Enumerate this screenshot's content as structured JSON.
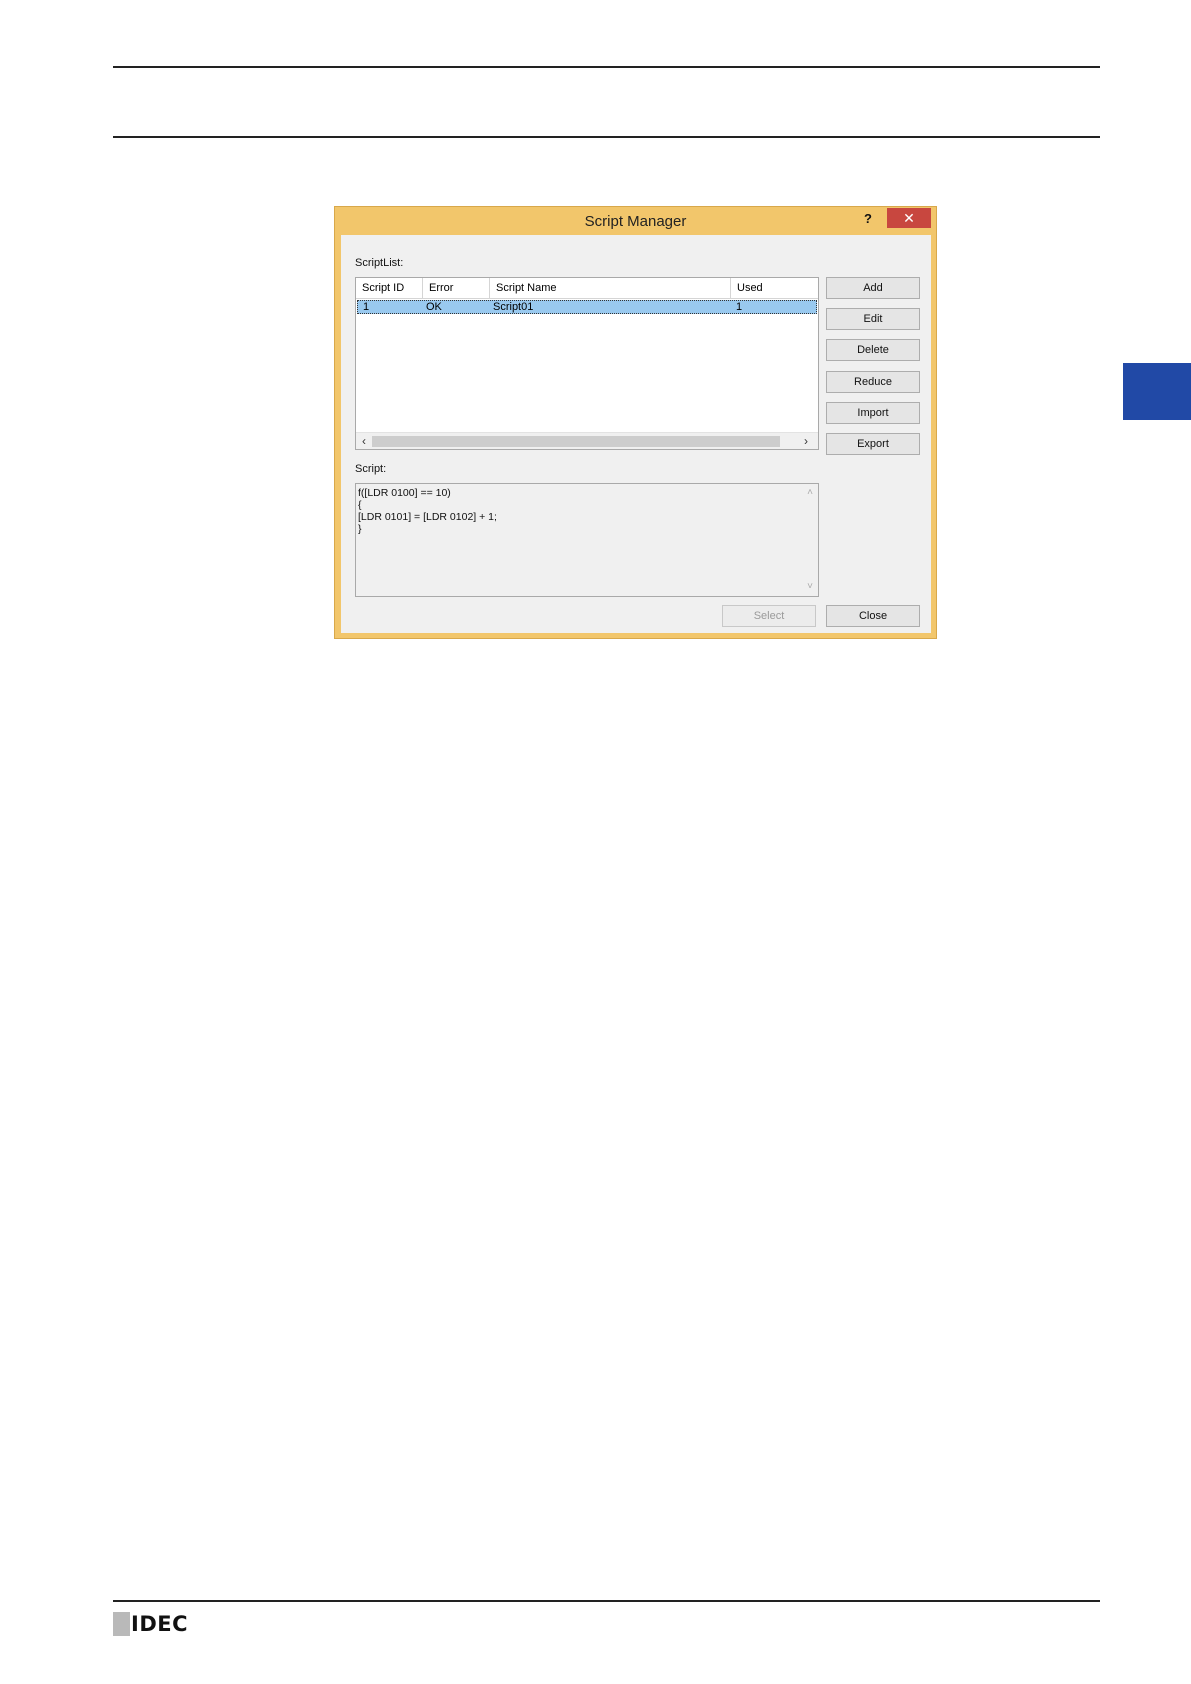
{
  "dialog": {
    "title": "Script Manager",
    "help_label": "?",
    "close_label": "✕",
    "script_list_label": "ScriptList:",
    "columns": [
      "Script ID",
      "Error",
      "Script Name",
      "Used"
    ],
    "rows": [
      {
        "id": "1",
        "error": "OK",
        "name": "Script01",
        "used": "1"
      }
    ],
    "buttons": {
      "add": "Add",
      "edit": "Edit",
      "delete": "Delete",
      "reduce": "Reduce",
      "import": "Import",
      "export": "Export",
      "select": "Select",
      "close": "Close"
    },
    "script_label": "Script:",
    "script_lines": [
      "f([LDR 0100] == 10)",
      "{",
      "[LDR 0101] = [LDR 0102] + 1;",
      "}"
    ]
  },
  "footer": {
    "logo": "IDEC"
  },
  "colors": {
    "title_bar": "#f2c66b",
    "close_button": "#c8473f",
    "selection": "#99c9ef",
    "tab_marker": "#2149a6"
  }
}
